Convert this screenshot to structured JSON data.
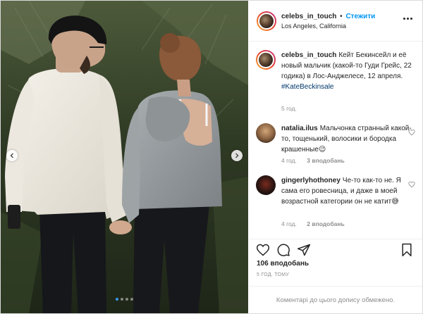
{
  "post": {
    "author": "celebs_in_touch",
    "separator": "•",
    "follow_label": "Стежити",
    "location": "Los Angeles, California",
    "carousel": {
      "slide_count": 4,
      "active_index": 0
    }
  },
  "caption": {
    "username": "celebs_in_touch",
    "text": "Кейт Бекинсейл и её новый мальчик (какой-то Гуди Грейс, 22 годика) в Лос-Анджелесе, 12 апреля.",
    "hashtag": "#KateBeckinsale",
    "time": "5 год."
  },
  "comments": [
    {
      "username": "natalia.ilus",
      "text": "Мальчонка странный какой-то, тощенький, волосики и бородка крашенные😉",
      "time": "4 год.",
      "likes": "3 вподобань"
    },
    {
      "username": "gingerlyhothoney",
      "text": "Че-то как-то не. Я сама его ровесница, и даже в моей возрастной категории он не катит😅",
      "time": "4 год.",
      "likes": "2 вподобань"
    }
  ],
  "stats": {
    "likes": "106 вподобань",
    "posted": "5 ГОД. ТОМУ"
  },
  "footer": {
    "comments_disabled": "Коментарі до цього допису обмежено."
  },
  "icons": {
    "like": "heart-icon",
    "comment": "comment-icon",
    "share": "paper-plane-icon",
    "save": "bookmark-icon",
    "more": "ellipsis-icon"
  },
  "colors": {
    "link_blue": "#0095f6",
    "hashtag_blue": "#00376b",
    "text": "#262626",
    "muted": "#8e8e8e",
    "active_dot": "#3897f0"
  }
}
